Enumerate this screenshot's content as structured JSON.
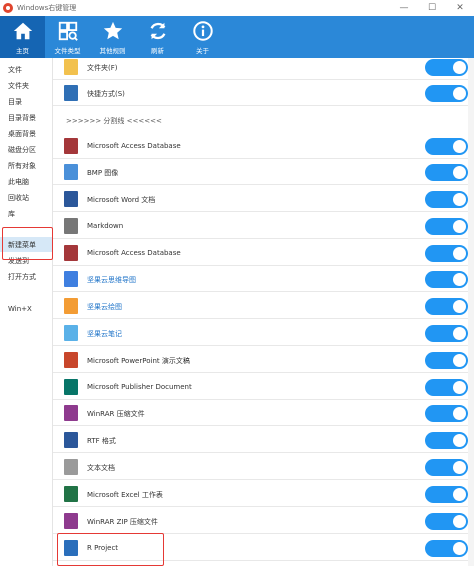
{
  "window": {
    "title": "Windows右键管理",
    "controls": {
      "minimize": "—",
      "maximize": "☐",
      "close": "✕"
    }
  },
  "toolbar": {
    "buttons": [
      {
        "label": "主页",
        "icon": "home-icon",
        "active": true
      },
      {
        "label": "文件类型",
        "icon": "grid-icon",
        "active": false
      },
      {
        "label": "其他规则",
        "icon": "star-icon",
        "active": false
      },
      {
        "label": "刷新",
        "icon": "refresh-icon",
        "active": false
      },
      {
        "label": "关于",
        "icon": "info-icon",
        "active": false
      }
    ]
  },
  "sidebar": {
    "items": [
      {
        "label": "文件"
      },
      {
        "label": "文件夹"
      },
      {
        "label": "目录"
      },
      {
        "label": "目录背景"
      },
      {
        "label": "桌面背景"
      },
      {
        "label": "磁盘分区"
      },
      {
        "label": "所有对象"
      },
      {
        "label": "此电脑"
      },
      {
        "label": "回收站"
      },
      {
        "label": "库"
      },
      {
        "label": "新建菜单"
      },
      {
        "label": "发送到"
      },
      {
        "label": "打开方式"
      },
      {
        "label": "Win+X"
      }
    ],
    "selected": "新建菜单"
  },
  "list": {
    "separator": ">>>>>> 分割线 <<<<<<",
    "rows": [
      {
        "label": "文件夹(F)",
        "icon": "folder-icon",
        "color": "#f2c14e",
        "enabled": true
      },
      {
        "label": "快捷方式(S)",
        "icon": "shortcut-icon",
        "color": "#2f6fb5",
        "enabled": true
      },
      {
        "label": "Microsoft Access Database",
        "icon": "access-icon",
        "color": "#a4373a",
        "enabled": true
      },
      {
        "label": "BMP 图像",
        "icon": "image-icon",
        "color": "#4a90d9",
        "enabled": true
      },
      {
        "label": "Microsoft Word 文档",
        "icon": "word-icon",
        "color": "#2b579a",
        "enabled": true
      },
      {
        "label": "Markdown",
        "icon": "markdown-icon",
        "color": "#777777",
        "enabled": true
      },
      {
        "label": "Microsoft Access Database",
        "icon": "access-icon",
        "color": "#a4373a",
        "enabled": true
      },
      {
        "label": "坚果云思维导图",
        "icon": "mindmap-icon",
        "color": "#3f7fe0",
        "enabled": true
      },
      {
        "label": "坚果云绘图",
        "icon": "drawing-icon",
        "color": "#f39c34",
        "enabled": true
      },
      {
        "label": "坚果云笔记",
        "icon": "note-icon",
        "color": "#5ab1e8",
        "enabled": true
      },
      {
        "label": "Microsoft PowerPoint 演示文稿",
        "icon": "powerpoint-icon",
        "color": "#c8462b",
        "enabled": true
      },
      {
        "label": "Microsoft Publisher Document",
        "icon": "publisher-icon",
        "color": "#077568",
        "enabled": true
      },
      {
        "label": "WinRAR 压缩文件",
        "icon": "winrar-icon",
        "color": "#8e3a8e",
        "enabled": true
      },
      {
        "label": "RTF 格式",
        "icon": "rtf-icon",
        "color": "#2b579a",
        "enabled": true
      },
      {
        "label": "文本文档",
        "icon": "text-icon",
        "color": "#9a9a9a",
        "enabled": true
      },
      {
        "label": "Microsoft Excel 工作表",
        "icon": "excel-icon",
        "color": "#217346",
        "enabled": true
      },
      {
        "label": "WinRAR ZIP 压缩文件",
        "icon": "winrar-zip-icon",
        "color": "#8e3a8e",
        "enabled": true
      },
      {
        "label": "R Project",
        "icon": "r-project-icon",
        "color": "#2a6ebb",
        "enabled": true
      }
    ]
  },
  "colors": {
    "accent": "#2b88d8",
    "toggle_on": "#2196f3",
    "highlight": "#e53935"
  }
}
